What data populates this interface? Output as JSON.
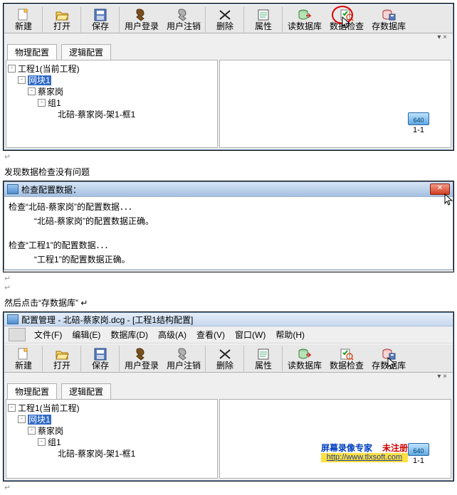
{
  "toolbar": {
    "new": "新建",
    "open": "打开",
    "save": "保存",
    "login": "用户登录",
    "logout": "用户注销",
    "delete": "删除",
    "prop": "属性",
    "readdb": "读数据库",
    "check": "数据检查",
    "savedb": "存数据库"
  },
  "toolbar2_check": "数据检查",
  "toolbar2_savedb": "存数据库",
  "tabs": {
    "phys": "物理配置",
    "logic": "逻辑配置"
  },
  "tree": {
    "root": "工程1(当前工程)",
    "net": "网块1",
    "site": "蔡家岗",
    "group": "组1",
    "rack": "北碚-蔡家岗-架1-框1"
  },
  "device": {
    "chip": "640",
    "label": "1-1"
  },
  "para1": "发现数据检查没有问题",
  "logwin": {
    "title": "检查配置数据：",
    "l1": "检查“北碚-蔡家岗”的配置数据．．．",
    "l2": "“北碚-蔡家岗”的配置数据正确。",
    "l3": "检查“工程1”的配置数据．．．",
    "l4": "“工程1”的配置数据正确。"
  },
  "para2": "然后点击“存数据库”",
  "win2": {
    "title": "配置管理 - 北碚-蔡家岗.dcg - [工程1结构配置]",
    "menu": {
      "file": "文件(F)",
      "edit": "编辑(E)",
      "db": "数据库(D)",
      "adv": "高级(A)",
      "view": "查看(V)",
      "win": "窗口(W)",
      "help": "帮助(H)"
    }
  },
  "watermark": {
    "l1a": "屏幕录像专家",
    "l1b": "未注册",
    "l2": "http://www.tlxsoft.com"
  },
  "pin": "▾ ×"
}
